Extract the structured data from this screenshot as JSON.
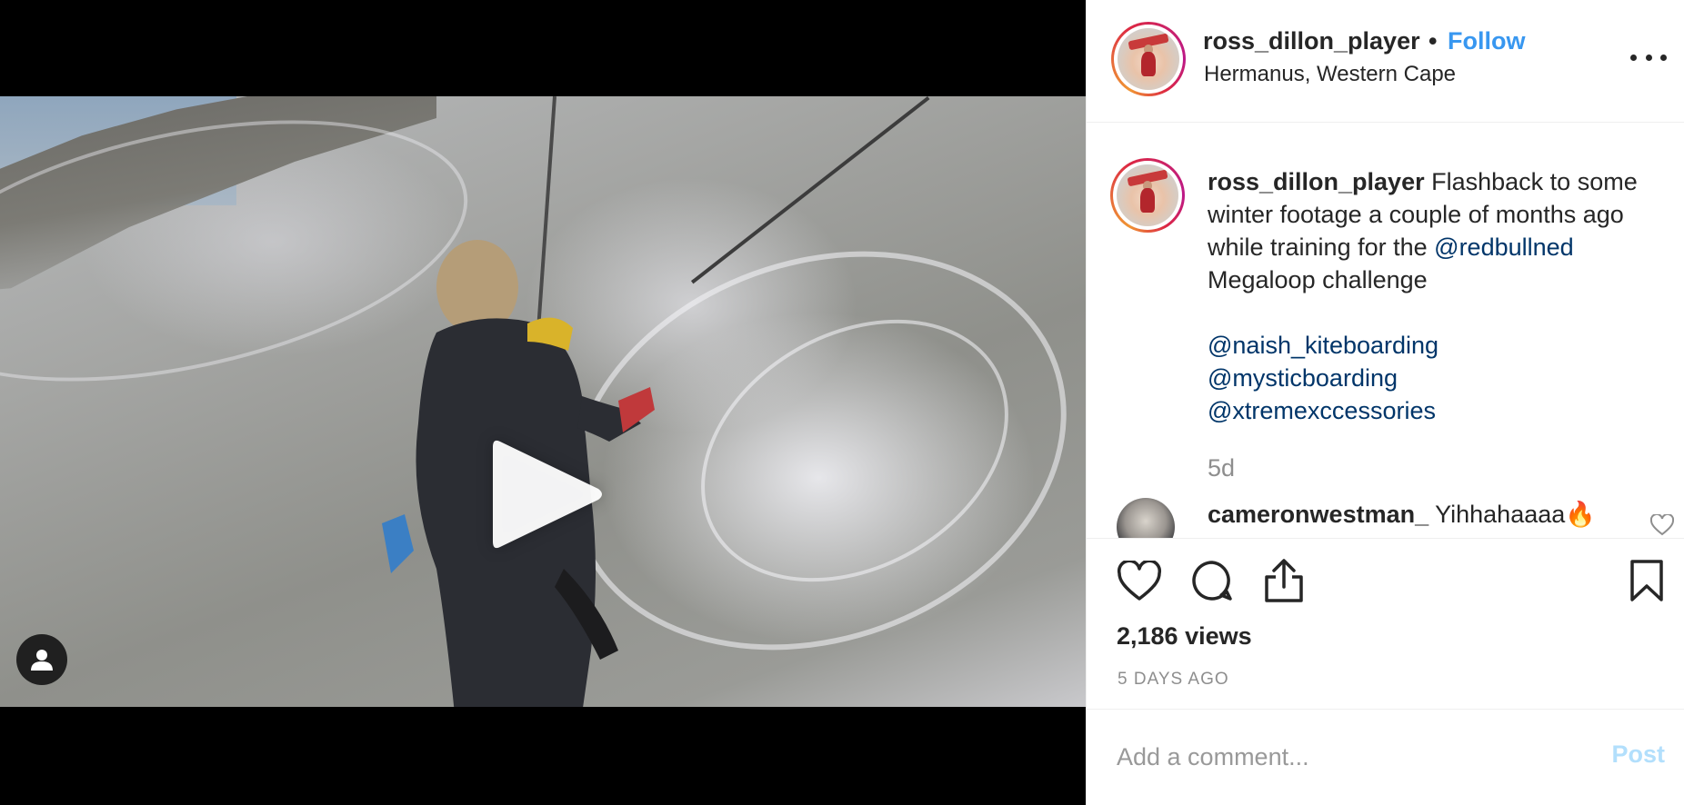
{
  "header": {
    "username": "ross_dillon_player",
    "separator": "•",
    "follow_label": "Follow",
    "location": "Hermanus, Western Cape"
  },
  "caption": {
    "username": "ross_dillon_player",
    "text_1": "Flashback to some winter footage a couple of months ago while training for the",
    "mention_1": "@redbullned",
    "text_2": "Megaloop challenge",
    "mentions": [
      "@naish_kiteboarding",
      "@mysticboarding",
      "@xtremexccessories"
    ],
    "age": "5d"
  },
  "comment": {
    "username": "cameronwestman_",
    "text": "Yihhahaaaa🔥"
  },
  "stats": {
    "views": "2,186 views",
    "timestamp": "5 DAYS AGO"
  },
  "add_comment": {
    "placeholder": "Add a comment...",
    "post_label": "Post"
  },
  "colors": {
    "link_blue": "#3897f0",
    "mention_blue": "#003569",
    "post_disabled": "#b2dffc",
    "secondary_text": "#8e8e8e"
  },
  "icons": [
    "play-icon",
    "user-tag-icon",
    "more-options-icon",
    "heart-icon",
    "comment-icon",
    "share-icon",
    "bookmark-icon",
    "small-heart-icon"
  ]
}
